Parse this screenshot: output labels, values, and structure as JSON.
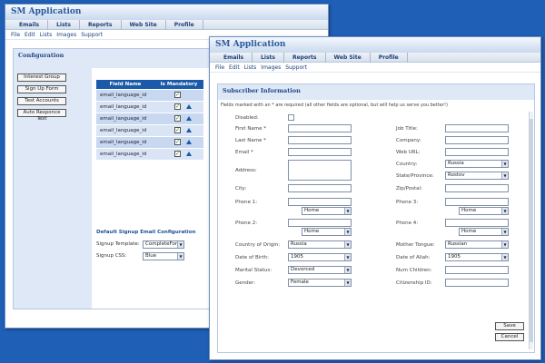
{
  "app_title": "SM Application",
  "nav_tabs": [
    "Emails",
    "Lists",
    "Reports",
    "Web Site",
    "Profile"
  ],
  "menu_items": [
    "File",
    "Edit",
    "Lists",
    "Images",
    "Support"
  ],
  "config": {
    "title": "Configuration",
    "side_buttons": [
      "Interest Group",
      "Sign Up Form",
      "Test Accounts",
      "Auto Responce Text"
    ],
    "table_headers": [
      "Field Name",
      "Is Mandatory"
    ],
    "rows": [
      {
        "field": "email_language_id",
        "mandatory": true,
        "arrow": false
      },
      {
        "field": "email_language_id",
        "mandatory": true,
        "arrow": true
      },
      {
        "field": "email_language_id",
        "mandatory": true,
        "arrow": true
      },
      {
        "field": "email_language_id",
        "mandatory": true,
        "arrow": true
      },
      {
        "field": "email_language_id",
        "mandatory": true,
        "arrow": true
      },
      {
        "field": "email_language_id",
        "mandatory": true,
        "arrow": true
      }
    ],
    "email_config_title": "Default Signup Email Configuration",
    "signup_template_label": "Signup Template:",
    "signup_template_value": "CompleteForm",
    "signup_css_label": "Signup CSS:",
    "signup_css_value": "Blue"
  },
  "subscriber": {
    "title": "Subscriber Information",
    "note": "Fields marked with an * are required  (all other fields are optional, but will help us serve you better!)",
    "disabled_label": "Disabled:",
    "first_name_label": "First Name *",
    "last_name_label": "Last Name *",
    "email_label": "Email *",
    "address_label": "Address:",
    "city_label": "City:",
    "phone1_label": "Phone 1:",
    "phone1_type": "Home",
    "phone2_label": "Phone 2:",
    "phone2_type": "Home",
    "country_origin_label": "Country of Origin:",
    "country_origin_value": "Russia",
    "dob_label": "Date of Birth:",
    "dob_value": "1905",
    "marital_label": "Marital Status:",
    "marital_value": "Devorced",
    "gender_label": "Gender:",
    "gender_value": "Female",
    "job_title_label": "Job Title:",
    "company_label": "Company:",
    "web_url_label": "Web URL:",
    "country_label": "Country:",
    "country_value": "Russia",
    "state_label": "State/Province:",
    "state_value": "Rostov",
    "zip_label": "Zip/Postal:",
    "phone3_label": "Phone 3:",
    "phone3_type": "Home",
    "phone4_label": "Phone 4:",
    "phone4_type": "Home",
    "mother_tongue_label": "Mother Tongue:",
    "mother_tongue_value": "Russian",
    "aliah_label": "Date of Aliah:",
    "aliah_value": "1905",
    "num_children_label": "Num Children:",
    "citizenship_label": "Citizenship ID:",
    "save_label": "Save",
    "cancel_label": "Cancel"
  }
}
